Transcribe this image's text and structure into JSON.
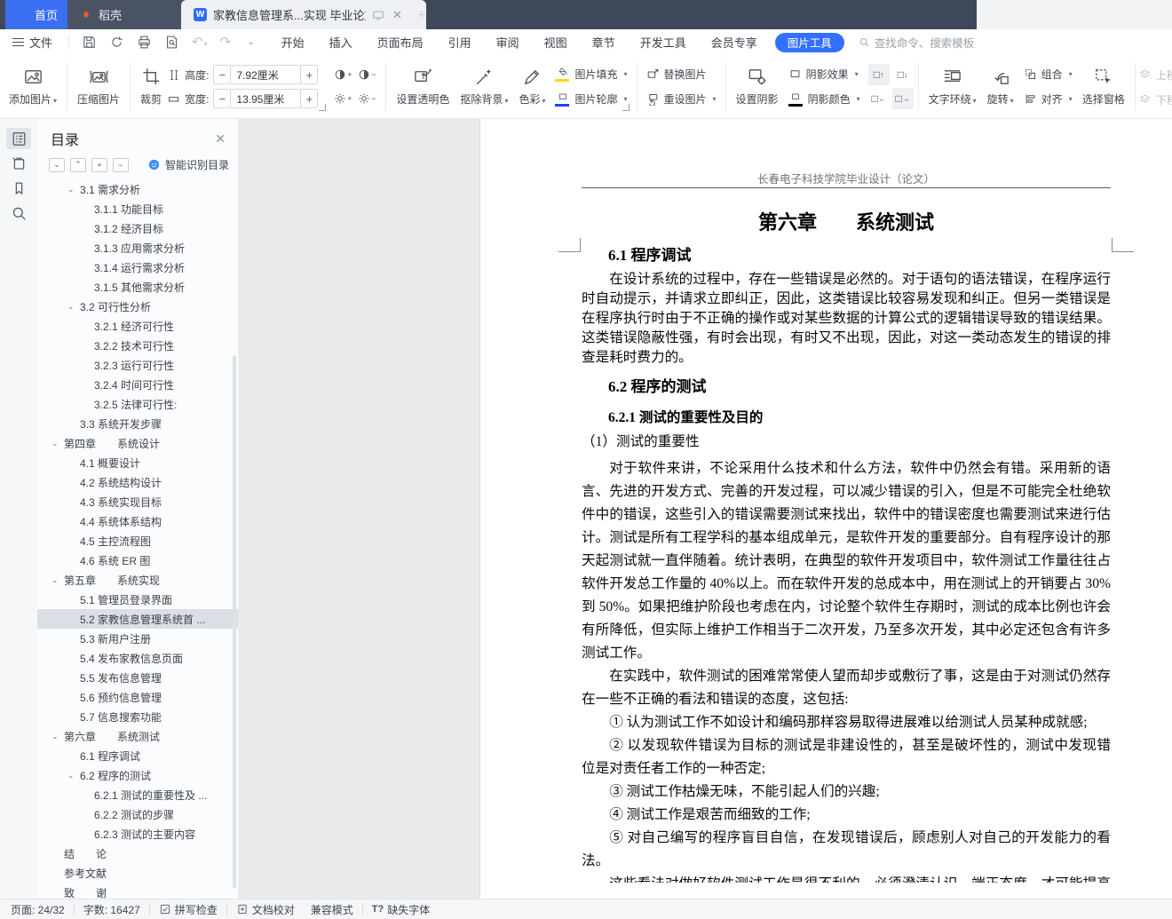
{
  "colors": {
    "accent": "#3370ff",
    "tabbar_bg": "#3f4859",
    "docer_flame": "#eb5b2d",
    "fill_swatch": "#ffd800",
    "outline_swatch": "#2240ff",
    "shadow_swatch": "#000000"
  },
  "tabbar": {
    "home": "首页",
    "docer": "稻壳",
    "doc_title": "家教信息管理系...实现 毕业论文"
  },
  "menubar": {
    "file_label": "文件",
    "menus": [
      "开始",
      "插入",
      "页面布局",
      "引用",
      "审阅",
      "视图",
      "章节",
      "开发工具",
      "会员专享"
    ],
    "tool_tab": "图片工具",
    "search_placeholder": "查找命令、搜索模板"
  },
  "toolbar": {
    "add_picture": "添加图片",
    "compress": "压缩图片",
    "crop": "裁剪",
    "height_label": "高度:",
    "height_value": "7.92厘米",
    "width_label": "宽度:",
    "width_value": "13.95厘米",
    "set_transparent": "设置透明色",
    "remove_bg": "抠除背景",
    "color_tone": "色彩",
    "pic_fill": "图片填充",
    "pic_outline": "图片轮廓",
    "replace_pic": "替换图片",
    "reset_pic": "重设图片",
    "set_shadow": "设置阴影",
    "shadow_effect": "阴影效果",
    "shadow_color": "阴影颜色",
    "text_wrap": "文字环绕",
    "rotate": "旋转",
    "group": "组合",
    "align": "对齐",
    "selection_pane": "选择窗格",
    "move_up": "上移",
    "move_down": "下移"
  },
  "sidebar": {
    "panel_title": "目录",
    "smart_button": "智能识别目录",
    "toc": [
      {
        "label": "3.1 需求分析",
        "lv": 1,
        "chev": true
      },
      {
        "label": "3.1.1 功能目标",
        "lv": 2
      },
      {
        "label": "3.1.2 经济目标",
        "lv": 2
      },
      {
        "label": "3.1.3 应用需求分析",
        "lv": 2
      },
      {
        "label": "3.1.4 运行需求分析",
        "lv": 2
      },
      {
        "label": "3.1.5 其他需求分析",
        "lv": 2
      },
      {
        "label": "3.2 可行性分析",
        "lv": 1,
        "chev": true
      },
      {
        "label": "3.2.1 经济可行性",
        "lv": 2
      },
      {
        "label": "3.2.2 技术可行性",
        "lv": 2
      },
      {
        "label": "3.2.3  运行可行性",
        "lv": 2
      },
      {
        "label": "3.2.4  时间可行性",
        "lv": 2
      },
      {
        "label": "3.2.5  法律可行性:",
        "lv": 2
      },
      {
        "label": "3.3 系统开发步骤",
        "lv": 1
      },
      {
        "label": "第四章　　系统设计",
        "lv": 0,
        "chev": true
      },
      {
        "label": "4.1 概要设计",
        "lv": 1
      },
      {
        "label": "4.2 系统结构设计",
        "lv": 1
      },
      {
        "label": "4.3 系统实现目标",
        "lv": 1
      },
      {
        "label": "4.4 系统体系结构",
        "lv": 1
      },
      {
        "label": "4.5 主控流程图",
        "lv": 1
      },
      {
        "label": "4.6 系统 ER 图",
        "lv": 1
      },
      {
        "label": "第五章　　系统实现",
        "lv": 0,
        "chev": true
      },
      {
        "label": "5.1 管理员登录界面",
        "lv": 1
      },
      {
        "label": "5.2 家教信息管理系统首 ...",
        "lv": 1,
        "selected": true
      },
      {
        "label": "5.3 新用户注册",
        "lv": 1
      },
      {
        "label": "5.4 发布家教信息页面",
        "lv": 1
      },
      {
        "label": "5.5 发布信息管理",
        "lv": 1
      },
      {
        "label": "5.6 预约信息管理",
        "lv": 1
      },
      {
        "label": "5.7 信息搜索功能",
        "lv": 1
      },
      {
        "label": "第六章　　系统测试",
        "lv": 0,
        "chev": true
      },
      {
        "label": "6.1 程序调试",
        "lv": 1
      },
      {
        "label": "6.2 程序的测试",
        "lv": 1,
        "chev": true
      },
      {
        "label": "6.2.1 测试的重要性及 ...",
        "lv": 2
      },
      {
        "label": "6.2.2 测试的步骤",
        "lv": 2
      },
      {
        "label": "6.2.3 测试的主要内容",
        "lv": 2
      },
      {
        "label": "结　　论",
        "lv": 0
      },
      {
        "label": "参考文献",
        "lv": 0
      },
      {
        "label": "致　　谢",
        "lv": 0
      }
    ]
  },
  "document": {
    "page_header": "长春电子科技学院毕业设计（论文）",
    "chapter_title": "第六章　　系统测试",
    "h61": "6.1 程序调试",
    "p61": "在设计系统的过程中，存在一些错误是必然的。对于语句的语法错误，在程序运行时自动提示，并请求立即纠正，因此，这类错误比较容易发现和纠正。但另一类错误是在程序执行时由于不正确的操作或对某些数据的计算公式的逻辑错误导致的错误结果。这类错误隐蔽性强，有时会出现，有时又不出现，因此，对这一类动态发生的错误的排查是耗时费力的。",
    "h62": "6.2 程序的测试",
    "h621": "6.2.1 测试的重要性及目的",
    "sub1": "（1）测试的重要性",
    "p621a": "对于软件来讲，不论采用什么技术和什么方法，软件中仍然会有错。采用新的语言、先进的开发方式、完善的开发过程，可以减少错误的引入，但是不可能完全杜绝软件中的错误，这些引入的错误需要测试来找出，软件中的错误密度也需要测试来进行估计。测试是所有工程学科的基本组成单元，是软件开发的重要部分。自有程序设计的那天起测试就一直伴随着。统计表明，在典型的软件开发项目中，软件测试工作量往往占软件开发总工作量的 40%以上。而在软件开发的总成本中，用在测试上的开销要占 30%到 50%。如果把维护阶段也考虑在内，讨论整个软件生存期时，测试的成本比例也许会有所降低，但实际上维护工作相当于二次开发，乃至多次开发，其中必定还包含有许多测试工作。",
    "p621b": "在实践中，软件测试的困难常常使人望而却步或敷衍了事，这是由于对测试仍然存在一些不正确的看法和错误的态度，这包括:",
    "list": [
      "① 认为测试工作不如设计和编码那样容易取得进展难以给测试人员某种成就感;",
      "② 以发现软件错误为目标的测试是非建设性的，甚至是破坏性的，测试中发现错位是对责任者工作的一种否定;",
      "③ 测试工作枯燥无味，不能引起人们的兴趣;",
      "④ 测试工作是艰苦而细致的工作;",
      "⑤ 对自己编写的程序盲目自信，在发现错误后，顾虑别人对自己的开发能力的看法。"
    ],
    "partial_line": "这些看法对做好软件测试工作是很不利的，必须澄清认识，端正态度，才可能提高测试"
  },
  "statusbar": {
    "page": "页面: 24/32",
    "words": "字数: 16427",
    "spell": "拼写检查",
    "proofread": "文档校对",
    "compat": "兼容模式",
    "missing_font": "缺失字体"
  }
}
